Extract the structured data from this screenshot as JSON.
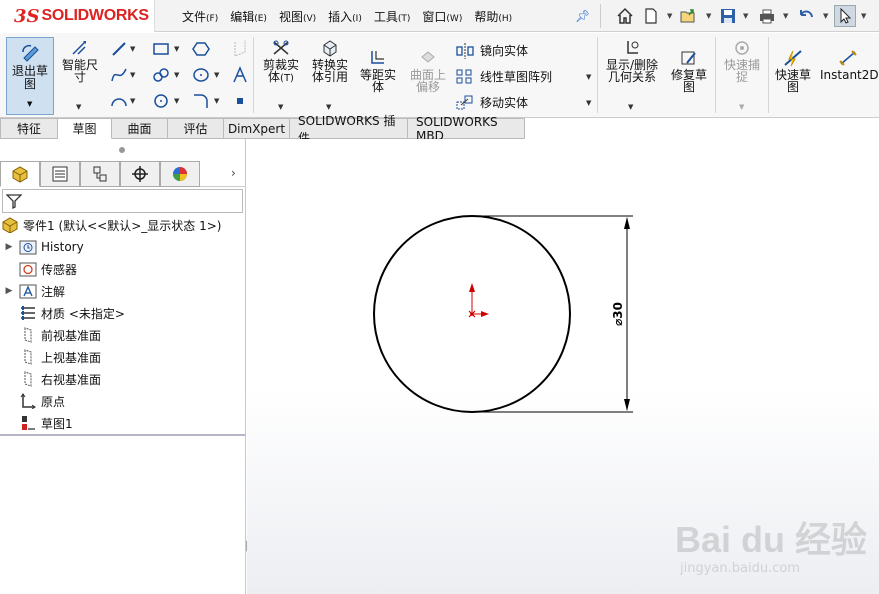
{
  "app": {
    "brand": "SOLIDWORKS",
    "ds_mark": "3S"
  },
  "menu": [
    {
      "label": "文件",
      "key": "(F)"
    },
    {
      "label": "编辑",
      "key": "(E)"
    },
    {
      "label": "视图",
      "key": "(V)"
    },
    {
      "label": "插入",
      "key": "(I)"
    },
    {
      "label": "工具",
      "key": "(T)"
    },
    {
      "label": "窗口",
      "key": "(W)"
    },
    {
      "label": "帮助",
      "key": "(H)"
    }
  ],
  "quick_access_icons": [
    "home-icon",
    "new-document-icon",
    "open-folder-icon",
    "save-icon",
    "print-icon",
    "undo-icon",
    "select-cursor-icon"
  ],
  "ribbon": {
    "exit_sketch": "退出草图",
    "smart_dimension": "智能尺寸",
    "trim_entities": "剪裁实体",
    "trim_entities_key": "(T)",
    "convert_entities": "转换实体引用",
    "offset_entities": "等距实体",
    "offset_on_surface": "曲面上偏移",
    "mirror_entities": "镜向实体",
    "linear_pattern": "线性草图阵列",
    "move_entities": "移动实体",
    "display_relations": "显示/删除几何关系",
    "repair_sketch": "修复草图",
    "quick_snaps": "快速捕捉",
    "rapid_sketch": "快速草图",
    "instant2d": "Instant2D"
  },
  "tabs": [
    "特征",
    "草图",
    "曲面",
    "评估",
    "DimXpert",
    "SOLIDWORKS 插件",
    "SOLIDWORKS MBD"
  ],
  "active_tab": "草图",
  "panel_tabs": [
    "feature-manager-tab",
    "property-manager-tab",
    "configuration-manager-tab",
    "dimxpert-manager-tab",
    "display-manager-tab"
  ],
  "tree": {
    "root": "零件1 (默认<<默认>_显示状态 1>)",
    "items": [
      {
        "label": "History",
        "icon": "history-icon",
        "expandable": true
      },
      {
        "label": "传感器",
        "icon": "sensor-icon",
        "expandable": false
      },
      {
        "label": "注解",
        "icon": "annotation-icon",
        "expandable": true
      },
      {
        "label": "材质 <未指定>",
        "icon": "material-icon",
        "expandable": false
      },
      {
        "label": "前视基准面",
        "icon": "plane-icon",
        "expandable": false
      },
      {
        "label": "上视基准面",
        "icon": "plane-icon",
        "expandable": false
      },
      {
        "label": "右视基准面",
        "icon": "plane-icon",
        "expandable": false
      },
      {
        "label": "原点",
        "icon": "origin-icon",
        "expandable": false
      },
      {
        "label": "草图1",
        "icon": "sketch-icon",
        "expandable": false
      }
    ]
  },
  "sketch": {
    "dimension_label": "⌀30",
    "diameter": 30,
    "shape": "circle"
  },
  "watermark": {
    "brand": "Bai du 经验",
    "url": "jingyan.baidu.com"
  },
  "colors": {
    "logo_red": "#d22222",
    "accent_blue": "#1a4f9c",
    "origin_red": "#d00000"
  }
}
